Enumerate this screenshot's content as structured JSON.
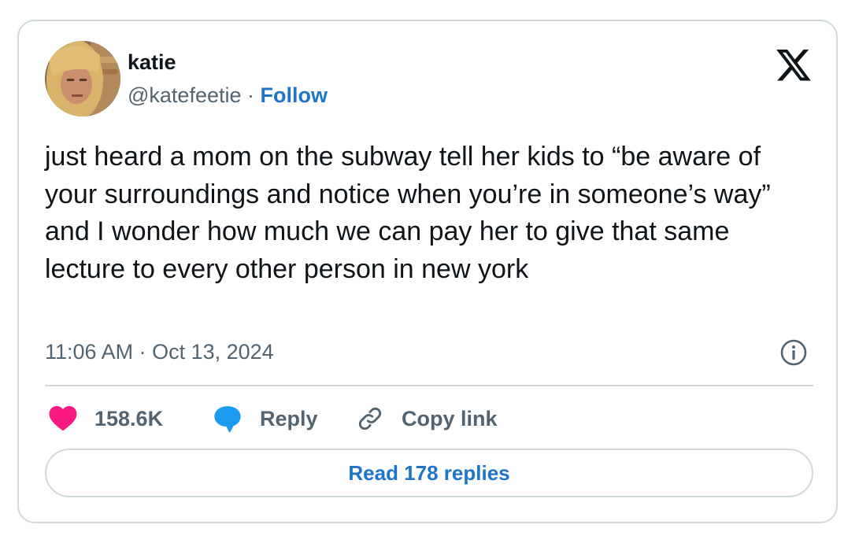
{
  "author": {
    "name": "katie",
    "handle": "@katefeetie",
    "separator": " · ",
    "follow_label": "Follow"
  },
  "tweet": {
    "text": "just heard a mom on the subway tell her kids to “be aware of your surroundings and notice when you’re in someone’s way” and I wonder how much we can pay her to give that same lecture to every other person in new york",
    "timestamp": "11:06 AM · Oct 13, 2024"
  },
  "actions": {
    "like_count": "158.6K",
    "reply_label": "Reply",
    "copy_label": "Copy link"
  },
  "footer": {
    "read_replies_label": "Read 178 replies"
  },
  "icons": {
    "brand": "x-logo-icon",
    "info": "info-icon",
    "like": "heart-icon",
    "reply": "speech-bubble-icon",
    "copy": "link-icon"
  },
  "colors": {
    "text": "#0f1419",
    "muted": "#536471",
    "link": "#1d74c9",
    "heart": "#f91880",
    "reply": "#1d9bf0",
    "border": "#cfd9de"
  }
}
